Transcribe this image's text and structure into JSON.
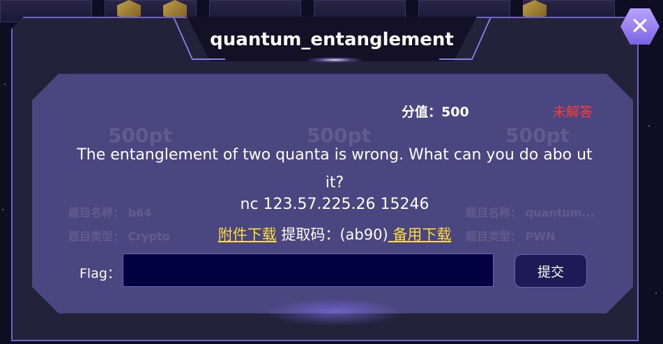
{
  "modal": {
    "title": "quantum_entanglement",
    "close_icon": "close-icon",
    "score_label": "分值：500",
    "status": "未解答",
    "description": "The entanglement of two quanta is wrong. What can you do abo ut it?",
    "connection": "nc 123.57.225.26 15246",
    "attachment_link": "附件下载",
    "extract_code_label": " 提取码：(ab90)",
    "backup_link": " 备用下载",
    "flag_label": "Flag：",
    "flag_value": "",
    "submit_label": "提交"
  },
  "colors": {
    "accent": "#6f63c9",
    "status_red": "#ff3b3b",
    "link_yellow": "#ffdd3a",
    "input_bg": "#010040"
  }
}
